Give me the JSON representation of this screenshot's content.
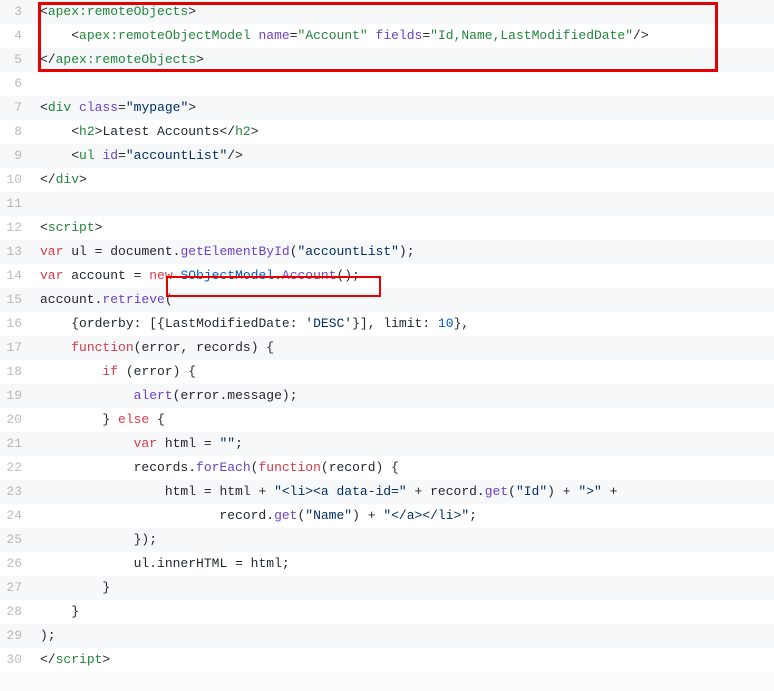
{
  "lines": [
    {
      "n": 3,
      "tokens": [
        [
          "punct",
          "<"
        ],
        [
          "tag",
          "apex:remoteObjects"
        ],
        [
          "punct",
          ">"
        ]
      ]
    },
    {
      "n": 4,
      "tokens": [
        [
          "ident",
          "    "
        ],
        [
          "punct",
          "<"
        ],
        [
          "tag",
          "apex:remoteObjectModel"
        ],
        [
          "ident",
          " "
        ],
        [
          "attr-name",
          "name"
        ],
        [
          "punct",
          "="
        ],
        [
          "dkgreen",
          "\"Account\""
        ],
        [
          "ident",
          " "
        ],
        [
          "attr-name",
          "fields"
        ],
        [
          "punct",
          "="
        ],
        [
          "dkgreen",
          "\"Id,Name,LastModifiedDate\""
        ],
        [
          "punct",
          "/>"
        ]
      ]
    },
    {
      "n": 5,
      "tokens": [
        [
          "punct",
          "</"
        ],
        [
          "tag",
          "apex:remoteObjects"
        ],
        [
          "punct",
          ">"
        ]
      ]
    },
    {
      "n": 6,
      "tokens": []
    },
    {
      "n": 7,
      "tokens": [
        [
          "punct",
          "<"
        ],
        [
          "tag",
          "div"
        ],
        [
          "ident",
          " "
        ],
        [
          "attr-name",
          "class"
        ],
        [
          "punct",
          "="
        ],
        [
          "string",
          "\"mypage\""
        ],
        [
          "punct",
          ">"
        ]
      ]
    },
    {
      "n": 8,
      "tokens": [
        [
          "ident",
          "    "
        ],
        [
          "punct",
          "<"
        ],
        [
          "tag",
          "h2"
        ],
        [
          "punct",
          ">"
        ],
        [
          "ident",
          "Latest Accounts"
        ],
        [
          "punct",
          "</"
        ],
        [
          "tag",
          "h2"
        ],
        [
          "punct",
          ">"
        ]
      ]
    },
    {
      "n": 9,
      "tokens": [
        [
          "ident",
          "    "
        ],
        [
          "punct",
          "<"
        ],
        [
          "tag",
          "ul"
        ],
        [
          "ident",
          " "
        ],
        [
          "attr-name",
          "id"
        ],
        [
          "punct",
          "="
        ],
        [
          "string",
          "\"accountList\""
        ],
        [
          "punct",
          "/>"
        ]
      ]
    },
    {
      "n": 10,
      "tokens": [
        [
          "punct",
          "</"
        ],
        [
          "tag",
          "div"
        ],
        [
          "punct",
          ">"
        ]
      ]
    },
    {
      "n": 11,
      "tokens": []
    },
    {
      "n": 12,
      "tokens": [
        [
          "punct",
          "<"
        ],
        [
          "tag",
          "script"
        ],
        [
          "punct",
          ">"
        ]
      ]
    },
    {
      "n": 13,
      "tokens": [
        [
          "keyword",
          "var"
        ],
        [
          "ident",
          " ul "
        ],
        [
          "punct",
          "= "
        ],
        [
          "ident",
          "document"
        ],
        [
          "punct",
          "."
        ],
        [
          "func",
          "getElementById"
        ],
        [
          "punct",
          "("
        ],
        [
          "string",
          "\"accountList\""
        ],
        [
          "punct",
          ");"
        ]
      ]
    },
    {
      "n": 14,
      "tokens": [
        [
          "keyword",
          "var"
        ],
        [
          "ident",
          " account "
        ],
        [
          "punct",
          "= "
        ],
        [
          "keyword",
          "new"
        ],
        [
          "ident",
          " "
        ],
        [
          "blue",
          "SObjectModel"
        ],
        [
          "punct",
          "."
        ],
        [
          "func",
          "Account"
        ],
        [
          "punct",
          "();"
        ]
      ]
    },
    {
      "n": 15,
      "tokens": [
        [
          "ident",
          "account"
        ],
        [
          "punct",
          "."
        ],
        [
          "func",
          "retrieve"
        ],
        [
          "punct",
          "("
        ]
      ]
    },
    {
      "n": 16,
      "tokens": [
        [
          "ident",
          "    "
        ],
        [
          "punct",
          "{"
        ],
        [
          "ident",
          "orderby"
        ],
        [
          "punct",
          ": [{"
        ],
        [
          "ident",
          "LastModifiedDate"
        ],
        [
          "punct",
          ": "
        ],
        [
          "string",
          "'DESC'"
        ],
        [
          "punct",
          "}], "
        ],
        [
          "ident",
          "limit"
        ],
        [
          "punct",
          ": "
        ],
        [
          "blue",
          "10"
        ],
        [
          "punct",
          "},"
        ]
      ]
    },
    {
      "n": 17,
      "tokens": [
        [
          "ident",
          "    "
        ],
        [
          "keyword",
          "function"
        ],
        [
          "punct",
          "("
        ],
        [
          "ident",
          "error"
        ],
        [
          "punct",
          ", "
        ],
        [
          "ident",
          "records"
        ],
        [
          "punct",
          ") {"
        ]
      ]
    },
    {
      "n": 18,
      "tokens": [
        [
          "ident",
          "        "
        ],
        [
          "keyword",
          "if"
        ],
        [
          "ident",
          " "
        ],
        [
          "punct",
          "("
        ],
        [
          "ident",
          "error"
        ],
        [
          "punct",
          ") {"
        ]
      ]
    },
    {
      "n": 19,
      "tokens": [
        [
          "ident",
          "            "
        ],
        [
          "func",
          "alert"
        ],
        [
          "punct",
          "("
        ],
        [
          "ident",
          "error"
        ],
        [
          "punct",
          "."
        ],
        [
          "ident",
          "message"
        ],
        [
          "punct",
          ");"
        ]
      ]
    },
    {
      "n": 20,
      "tokens": [
        [
          "ident",
          "        "
        ],
        [
          "punct",
          "} "
        ],
        [
          "keyword",
          "else"
        ],
        [
          "ident",
          " "
        ],
        [
          "punct",
          "{"
        ]
      ]
    },
    {
      "n": 21,
      "tokens": [
        [
          "ident",
          "            "
        ],
        [
          "keyword",
          "var"
        ],
        [
          "ident",
          " html "
        ],
        [
          "punct",
          "= "
        ],
        [
          "string",
          "\"\""
        ],
        [
          "punct",
          ";"
        ]
      ]
    },
    {
      "n": 22,
      "tokens": [
        [
          "ident",
          "            records"
        ],
        [
          "punct",
          "."
        ],
        [
          "func",
          "forEach"
        ],
        [
          "punct",
          "("
        ],
        [
          "keyword",
          "function"
        ],
        [
          "punct",
          "("
        ],
        [
          "ident",
          "record"
        ],
        [
          "punct",
          ") {"
        ]
      ]
    },
    {
      "n": 23,
      "tokens": [
        [
          "ident",
          "                html "
        ],
        [
          "punct",
          "= "
        ],
        [
          "ident",
          "html "
        ],
        [
          "punct",
          "+ "
        ],
        [
          "string",
          "\"<li><a data-id=\""
        ],
        [
          "ident",
          " "
        ],
        [
          "punct",
          "+ "
        ],
        [
          "ident",
          "record"
        ],
        [
          "punct",
          "."
        ],
        [
          "func",
          "get"
        ],
        [
          "punct",
          "("
        ],
        [
          "string",
          "\"Id\""
        ],
        [
          "punct",
          ") "
        ],
        [
          "punct",
          "+ "
        ],
        [
          "string",
          "\">\""
        ],
        [
          "ident",
          " "
        ],
        [
          "punct",
          "+"
        ]
      ]
    },
    {
      "n": 24,
      "tokens": [
        [
          "ident",
          "                       record"
        ],
        [
          "punct",
          "."
        ],
        [
          "func",
          "get"
        ],
        [
          "punct",
          "("
        ],
        [
          "string",
          "\"Name\""
        ],
        [
          "punct",
          ") "
        ],
        [
          "punct",
          "+ "
        ],
        [
          "string",
          "\"</a></li>\""
        ],
        [
          "punct",
          ";"
        ]
      ]
    },
    {
      "n": 25,
      "tokens": [
        [
          "ident",
          "            "
        ],
        [
          "punct",
          "});"
        ]
      ]
    },
    {
      "n": 26,
      "tokens": [
        [
          "ident",
          "            ul"
        ],
        [
          "punct",
          "."
        ],
        [
          "ident",
          "innerHTML"
        ],
        [
          "ident",
          " "
        ],
        [
          "punct",
          "= "
        ],
        [
          "ident",
          "html"
        ],
        [
          "punct",
          ";"
        ]
      ]
    },
    {
      "n": 27,
      "tokens": [
        [
          "ident",
          "        "
        ],
        [
          "punct",
          "}"
        ]
      ]
    },
    {
      "n": 28,
      "tokens": [
        [
          "ident",
          "    "
        ],
        [
          "punct",
          "}"
        ]
      ]
    },
    {
      "n": 29,
      "tokens": [
        [
          "punct",
          ");"
        ]
      ]
    },
    {
      "n": 30,
      "tokens": [
        [
          "punct",
          "</"
        ],
        [
          "tag",
          "script"
        ],
        [
          "punct",
          ">"
        ]
      ]
    }
  ]
}
